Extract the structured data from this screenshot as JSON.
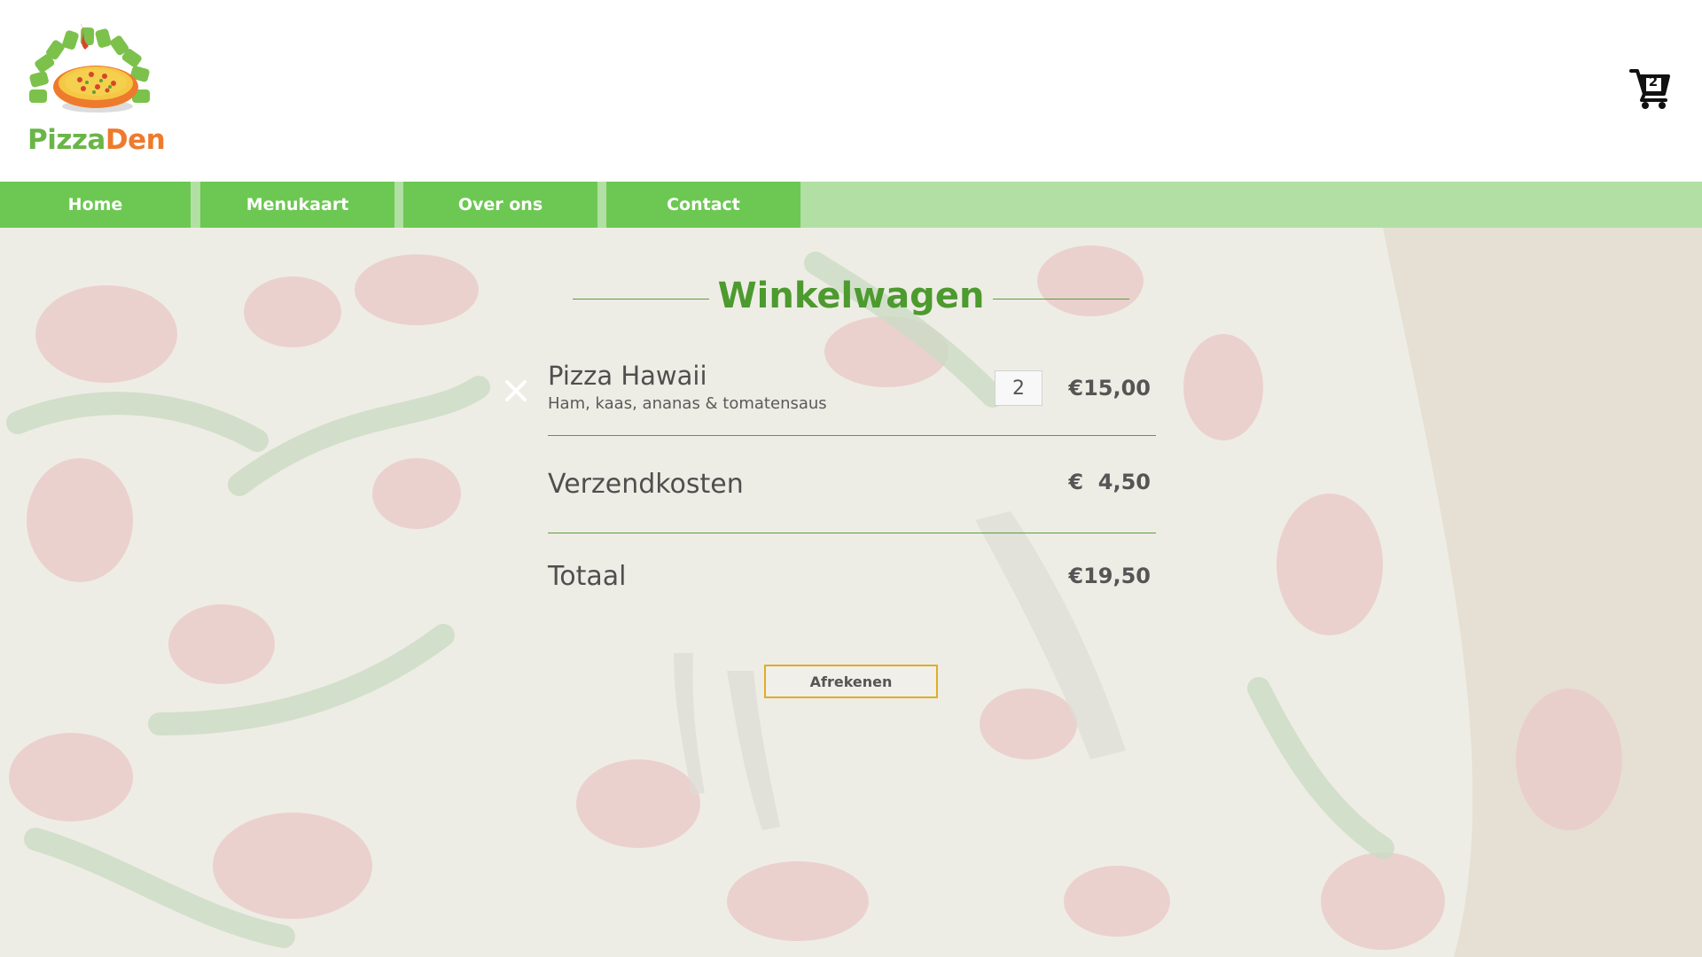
{
  "brand": {
    "name_part1": "Pizza",
    "name_part2": "Den"
  },
  "header": {
    "cart_count": "2"
  },
  "nav": {
    "items": [
      {
        "label": "Home"
      },
      {
        "label": "Menukaart"
      },
      {
        "label": "Over ons"
      },
      {
        "label": "Contact"
      }
    ]
  },
  "cart": {
    "title": "Winkelwagen",
    "items": [
      {
        "name": "Pizza Hawaii",
        "description": "Ham, kaas, ananas & tomatensaus",
        "quantity": "2",
        "price": "€15,00"
      }
    ],
    "shipping_label": "Verzendkosten",
    "shipping_price": "€  4,50",
    "total_label": "Totaal",
    "total_price": "€19,50",
    "checkout_label": "Afrekenen"
  },
  "icons": {
    "cart": "shopping-cart-icon",
    "remove": "close-icon",
    "logo": "pizza-oven-logo"
  },
  "colors": {
    "brand_green": "#6ab547",
    "brand_orange": "#ee7a2d",
    "nav_green": "#6cc852",
    "nav_bar": "#b2dfa4",
    "title_green": "#4d9a2e",
    "checkout_border": "#e2ad27"
  }
}
